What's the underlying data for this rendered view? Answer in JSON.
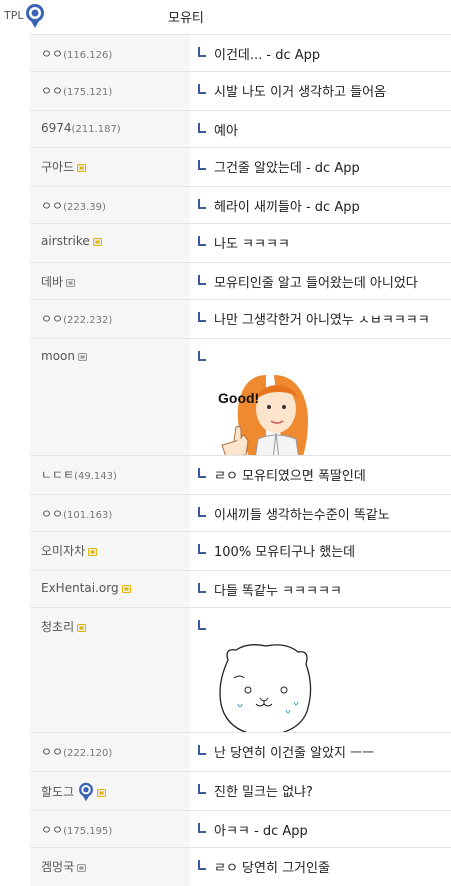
{
  "top": {
    "nick": "TPL",
    "text": "모유티",
    "badge_icon": "gallery-badge-icon"
  },
  "comments": [
    {
      "nick": "ㅇㅇ",
      "ip": "(116.126)",
      "text": "이건데... - dc App"
    },
    {
      "nick": "ㅇㅇ",
      "ip": "(175.121)",
      "text": "시발 나도 이거 생각하고 들어옴"
    },
    {
      "nick": "6974",
      "ip": "(211.187)",
      "text": "예아"
    },
    {
      "nick": "구아드",
      "lock": true,
      "lock_color": "#e2b400",
      "text": "그건줄 알았는데 - dc App"
    },
    {
      "nick": "ㅇㅇ",
      "ip": "(223.39)",
      "text": "헤라이 새끼들아 - dc App"
    },
    {
      "nick": "airstrike",
      "lock": true,
      "lock_color": "#e2b400",
      "text": "나도 ㅋㅋㅋㅋ"
    },
    {
      "nick": "데바",
      "lock": true,
      "lock_color": "#9a9a9a",
      "text": "모유티인줄 알고 들어왔는데 아니었다"
    },
    {
      "nick": "ㅇㅇ",
      "ip": "(222.232)",
      "text": "나만 그생각한거 아니였누 ㅅㅂㅋㅋㅋㅋ"
    },
    {
      "nick": "moon",
      "lock": true,
      "lock_color": "#9a9a9a",
      "text": "",
      "image": "thumbs-up-girl",
      "image_text": "Good!"
    },
    {
      "nick": "ㄴㄷㅌ",
      "ip": "(49.143)",
      "text": "ㄹㅇ 모유티였으면 폭딸인데"
    },
    {
      "nick": "ㅇㅇ",
      "ip": "(101.163)",
      "text": "이새끼들 생각하는수준이 똑같노"
    },
    {
      "nick": "오미자차",
      "lock": true,
      "lock_color": "#e2b400",
      "text": "100% 모유티구나 했는데"
    },
    {
      "nick": "ExHentai.org",
      "lock": true,
      "lock_color": "#e2b400",
      "text": "다들 똑같누 ㅋㅋㅋㅋㅋ"
    },
    {
      "nick": "청초리",
      "lock": true,
      "lock_color": "#e2b400",
      "text": "",
      "image": "crying-blob-sketch"
    },
    {
      "nick": "ㅇㅇ",
      "ip": "(222.120)",
      "text": "난 당연히 이건줄 알았지 ㅡㅡ"
    },
    {
      "nick": "할도그",
      "gallery_icon": true,
      "lock": true,
      "lock_color": "#e2b400",
      "text": "진한 밀크는 없냐?"
    },
    {
      "nick": "ㅇㅇ",
      "ip": "(175.195)",
      "text": "아ㅋㅋ - dc App"
    },
    {
      "nick": "겜멍국",
      "lock": true,
      "lock_color": "#9a9a9a",
      "text": "ㄹㅇ 당연히 그거인줄"
    }
  ]
}
